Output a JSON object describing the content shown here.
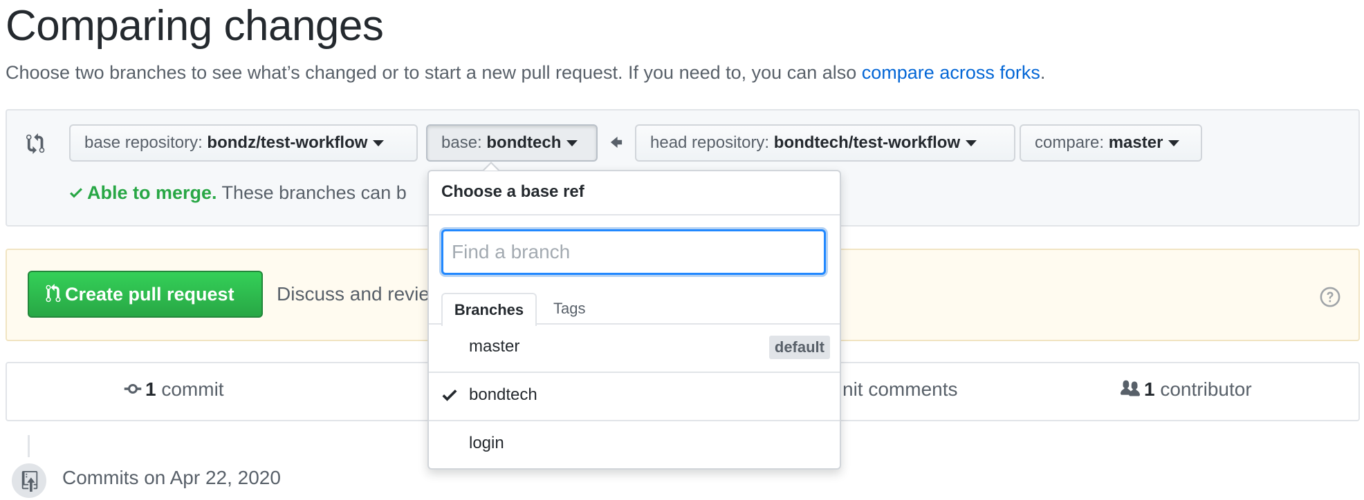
{
  "page": {
    "title": "Comparing changes",
    "subtitle_text": "Choose two branches to see what’s changed or to start a new pull request. If you need to, you can also ",
    "subtitle_link": "compare across forks",
    "subtitle_end": "."
  },
  "range": {
    "base_repo_label": "base repository: ",
    "base_repo_value": "bondz/test-workflow",
    "base_label": "base: ",
    "base_value": "bondtech",
    "head_repo_label": "head repository: ",
    "head_repo_value": "bondtech/test-workflow",
    "compare_label": "compare: ",
    "compare_value": "master",
    "merge_ok": "Able to merge.",
    "merge_text": " These branches can b"
  },
  "pr": {
    "create_label": "Create pull request",
    "discuss_text": "Discuss and revie",
    "discuss_end": "."
  },
  "summary": {
    "commits_count": "1",
    "commits_label": " commit",
    "comments_text": "nit comments",
    "contributors_count": "1",
    "contributors_label": " contributor"
  },
  "timeline": {
    "date_label": "Commits on Apr 22, 2020"
  },
  "dropdown": {
    "header": "Choose a base ref",
    "filter_placeholder": "Find a branch",
    "filter_value": "",
    "tabs": [
      "Branches",
      "Tags"
    ],
    "branches": [
      {
        "name": "master",
        "badge": "default",
        "selected": false
      },
      {
        "name": "bondtech",
        "badge": "",
        "selected": true
      },
      {
        "name": "login",
        "badge": "",
        "selected": false
      }
    ]
  },
  "colors": {
    "link": "#0366d6",
    "success": "#28a745",
    "focus": "#2188ff"
  },
  "icons": [
    "compare-icon",
    "arrow-left-icon",
    "check-icon",
    "git-pull-request-icon",
    "question-icon",
    "git-commit-icon",
    "people-icon",
    "repo-push-icon"
  ]
}
